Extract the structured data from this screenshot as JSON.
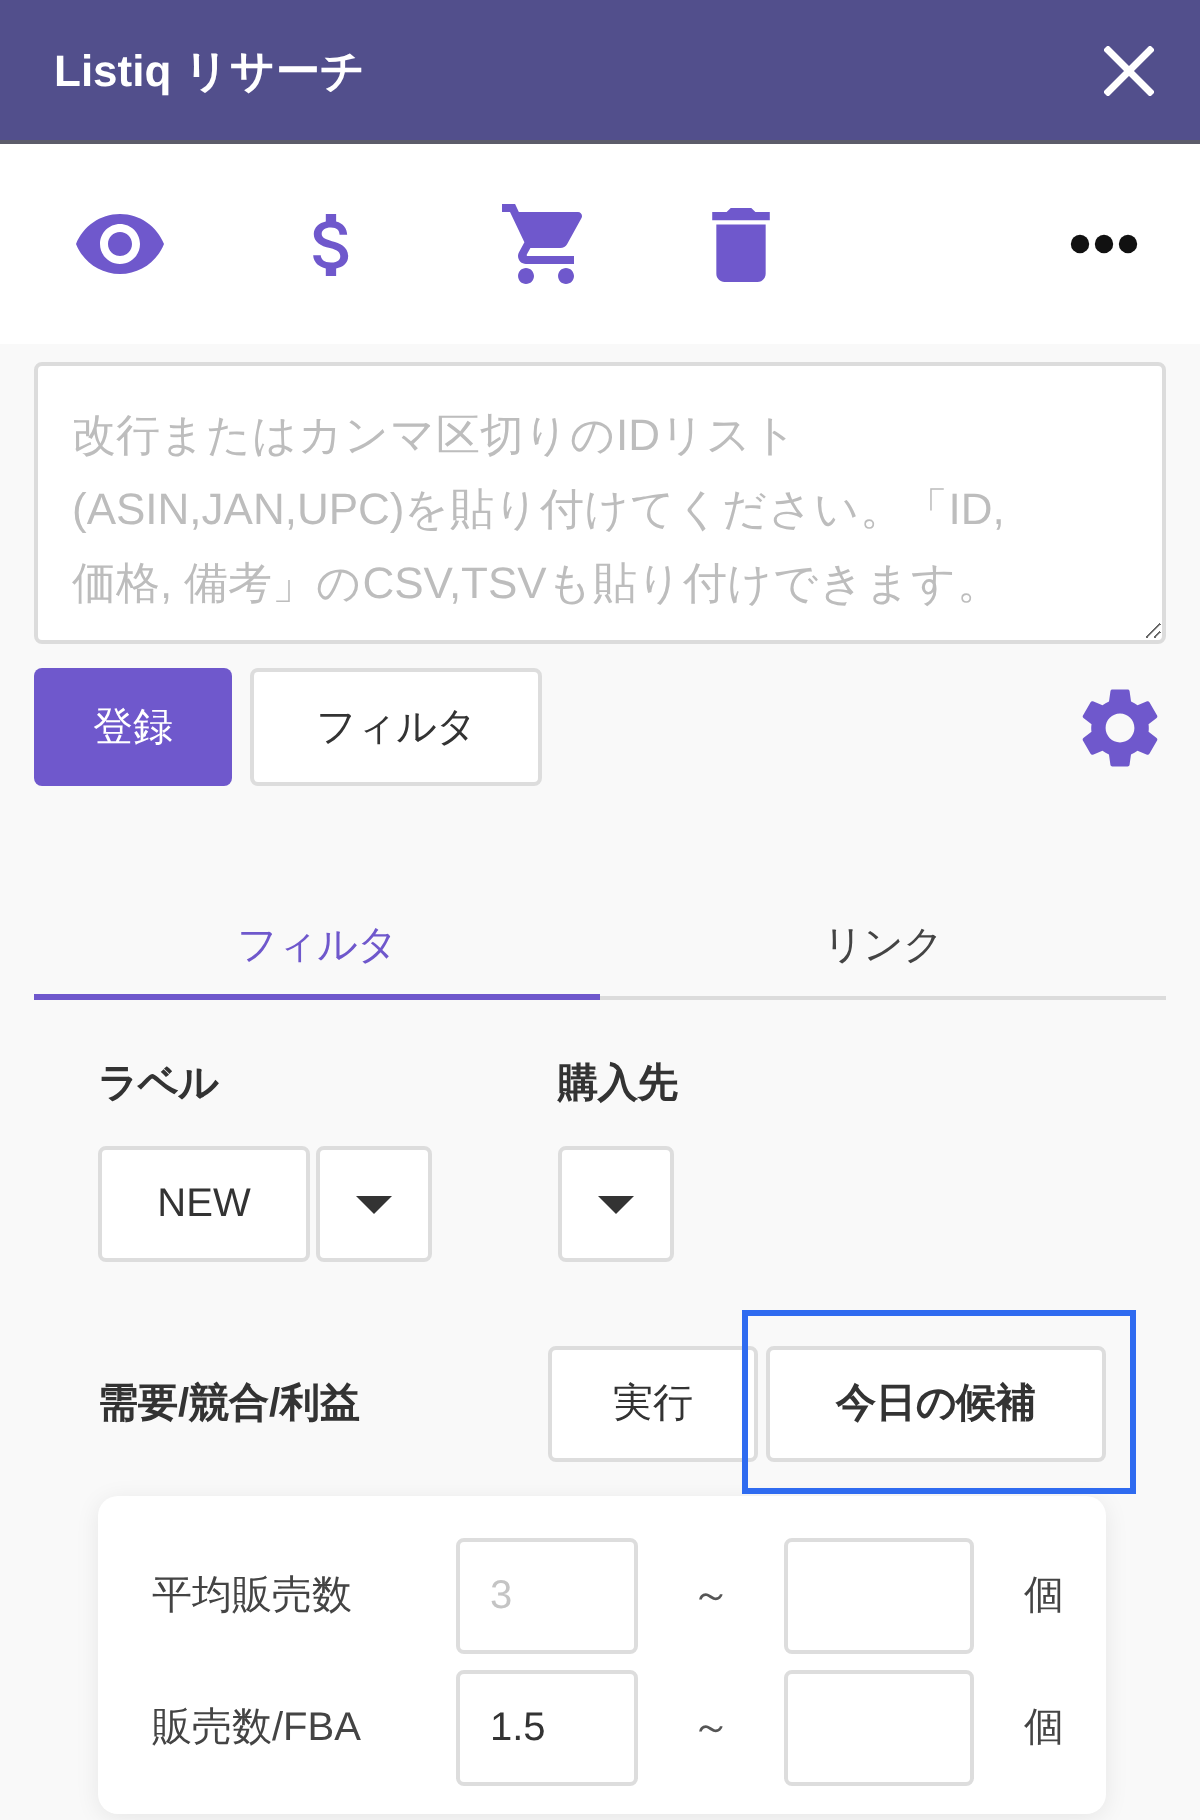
{
  "window": {
    "title": "Listiq リサーチ"
  },
  "id_input": {
    "placeholder": "改行またはカンマ区切りのIDリスト(ASIN,JAN,UPC)を貼り付けてください。「ID, 価格, 備考」のCSV,TSVも貼り付けできます。"
  },
  "actions": [
    {
      "label": "登録",
      "kind": "primary"
    },
    {
      "label": "フィルタ",
      "kind": "secondary"
    }
  ],
  "tabs": [
    {
      "label": "フィルタ",
      "selected": true
    },
    {
      "label": "リンク",
      "selected": false
    }
  ],
  "filters": [
    {
      "label": "ラベル",
      "value": "NEW"
    },
    {
      "label": "購入先"
    }
  ],
  "metrics": {
    "title": "需要/競合/利益",
    "buttons": [
      {
        "label": "実行",
        "highlighted": false
      },
      {
        "label": "今日の候補",
        "highlighted": true
      }
    ]
  },
  "ranges": [
    {
      "label": "平均販売数",
      "min": {
        "placeholder": "3"
      },
      "separator": "～",
      "unit": "個"
    },
    {
      "label": "販売数/FBA",
      "min": {
        "value": "1.5"
      },
      "separator": "～",
      "unit": "個"
    }
  ]
}
